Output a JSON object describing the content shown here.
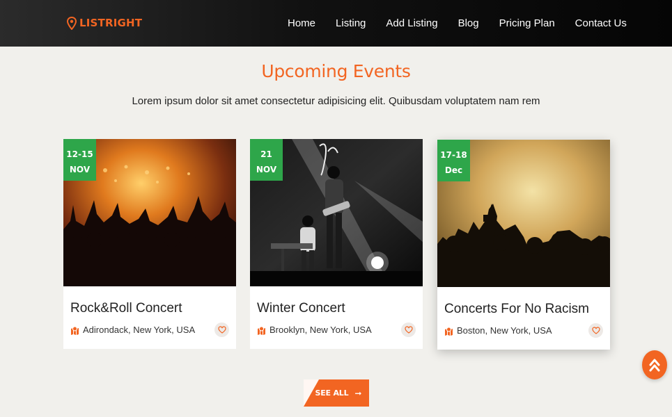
{
  "brand": {
    "name": "LISTRIGHT",
    "color": "#f26522"
  },
  "nav": [
    {
      "label": "Home"
    },
    {
      "label": "Listing"
    },
    {
      "label": "Add Listing"
    },
    {
      "label": "Blog"
    },
    {
      "label": "Pricing Plan"
    },
    {
      "label": "Contact Us"
    }
  ],
  "section": {
    "title": "Upcoming Events",
    "subtitle": "Lorem ipsum dolor sit amet consectetur adipisicing elit. Quibusdam voluptatem nam rem"
  },
  "events": [
    {
      "date_days": "12-15",
      "date_month": "NOV",
      "title": "Rock&Roll Concert",
      "location": "Adirondack, New York, USA",
      "image": "concert-crowd-orange"
    },
    {
      "date_days": "21",
      "date_month": "NOV",
      "title": "Winter Concert",
      "location": "Brooklyn, New York, USA",
      "image": "band-stage-bw"
    },
    {
      "date_days": "17-18",
      "date_month": "Dec",
      "title": "Concerts For No Racism",
      "location": "Boston, New York, USA",
      "image": "crowd-smoke-yellow"
    }
  ],
  "see_all": {
    "label": "SEE ALL"
  },
  "colors": {
    "accent": "#f26522",
    "date_badge": "#2ea64a",
    "background": "#f1f0ec"
  },
  "icons": {
    "logo": "map-pin-icon",
    "location": "map-location-icon",
    "favorite": "heart-icon",
    "arrow": "arrow-right-icon",
    "scroll": "double-chevron-up-icon"
  }
}
